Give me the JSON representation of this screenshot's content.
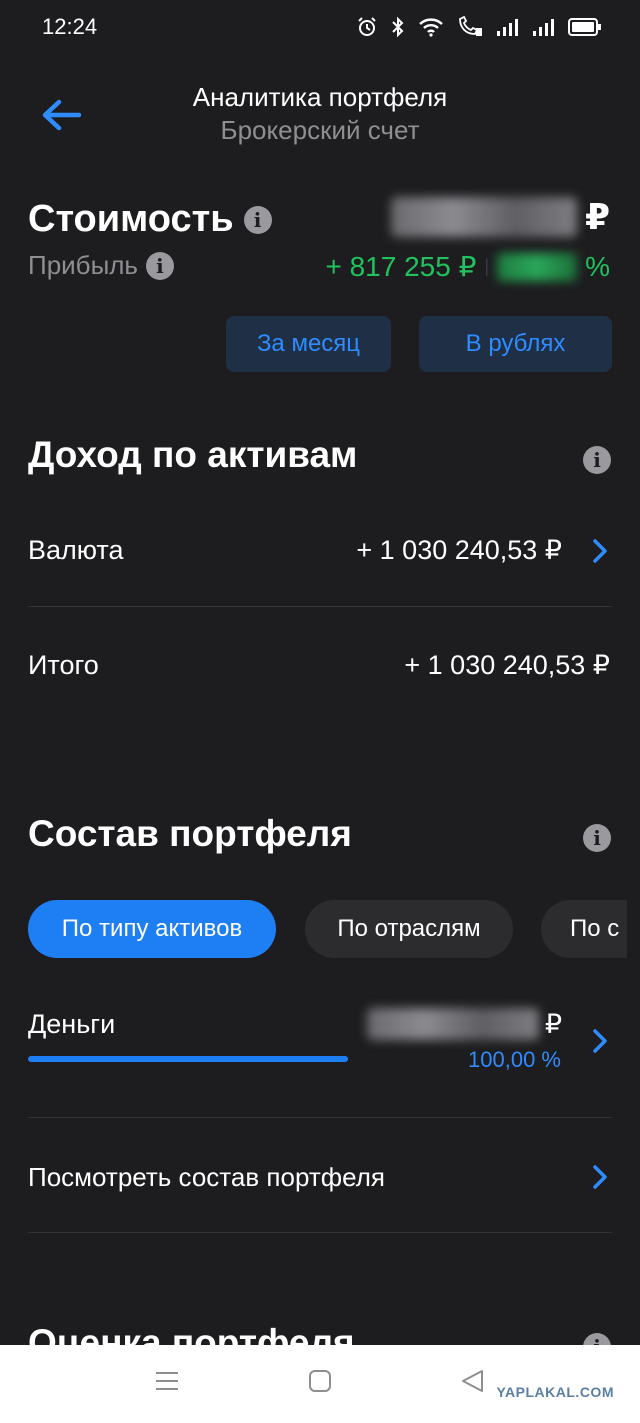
{
  "status_bar": {
    "time": "12:24",
    "icons": [
      "alarm-icon",
      "bluetooth-icon",
      "wifi-icon",
      "call-icon",
      "signal-icon",
      "signal-icon",
      "battery-icon"
    ]
  },
  "header": {
    "title": "Аналитика портфеля",
    "subtitle": "Брокерский счет"
  },
  "value": {
    "title": "Стоимость",
    "currency": "₽",
    "profit_label": "Прибыль",
    "profit_amount": "+ 817 255 ₽",
    "profit_sep": "|",
    "profit_percent_sign": "%"
  },
  "filters": {
    "period_label": "За месяц",
    "currency_label": "В рублях"
  },
  "income": {
    "title": "Доход по активам",
    "rows": [
      {
        "label": "Валюта",
        "value": "+ 1 030 240,53 ₽"
      },
      {
        "label": "Итого",
        "value": "+ 1 030 240,53 ₽"
      }
    ]
  },
  "composition": {
    "title": "Состав портфеля",
    "tabs": [
      {
        "label": "По типу активов",
        "active": true
      },
      {
        "label": "По отраслям",
        "active": false
      },
      {
        "label": "По с",
        "active": false
      }
    ],
    "items": [
      {
        "label": "Деньги",
        "currency": "₽",
        "percent": "100,00 %",
        "share": 1.0
      }
    ],
    "view_link": "Посмотреть состав портфеля"
  },
  "next_section": {
    "title": "Оценка портфеля"
  },
  "watermark": "YAPLAKAL.COM",
  "colors": {
    "background": "#1d1d1f",
    "accent": "#1e7ef3",
    "link": "#2f8cff",
    "profit": "#21c25e",
    "muted": "#8e8e93"
  }
}
